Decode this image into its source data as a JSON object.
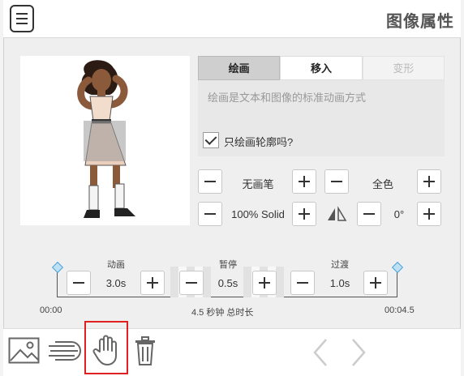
{
  "header": {
    "title": "图像属性",
    "menu_icon": "hamburger-menu-icon"
  },
  "tabs": [
    {
      "label": "绘画",
      "state": "active"
    },
    {
      "label": "移入",
      "state": "normal"
    },
    {
      "label": "变形",
      "state": "disabled"
    }
  ],
  "panel": {
    "description": "绘画是文本和图像的标准动画方式",
    "outline_only_label": "只绘画轮廓吗?",
    "outline_only_checked": true
  },
  "controls": {
    "pen_label": "无画笔",
    "color_label": "全色",
    "opacity_label": "100% Solid",
    "rotation_label": "0°",
    "flip_icon": "flip-triangle-icon"
  },
  "timeline": {
    "animation_label": "动画",
    "animation_value": "3.0s",
    "pause_label": "暂停",
    "pause_value": "0.5s",
    "transition_label": "过渡",
    "transition_value": "1.0s",
    "start_time": "00:00",
    "end_time": "00:04.5",
    "total_label": "4.5 秒钟 总时长"
  },
  "toolbar": {
    "image_icon": "image-icon",
    "lines_icon": "motion-lines-icon",
    "hand_icon": "hand-icon",
    "trash_icon": "trash-icon",
    "prev_icon": "chevron-left-icon",
    "next_icon": "chevron-right-icon"
  },
  "colors": {
    "highlight": "#e02020",
    "accent": "#4aa3d8"
  }
}
